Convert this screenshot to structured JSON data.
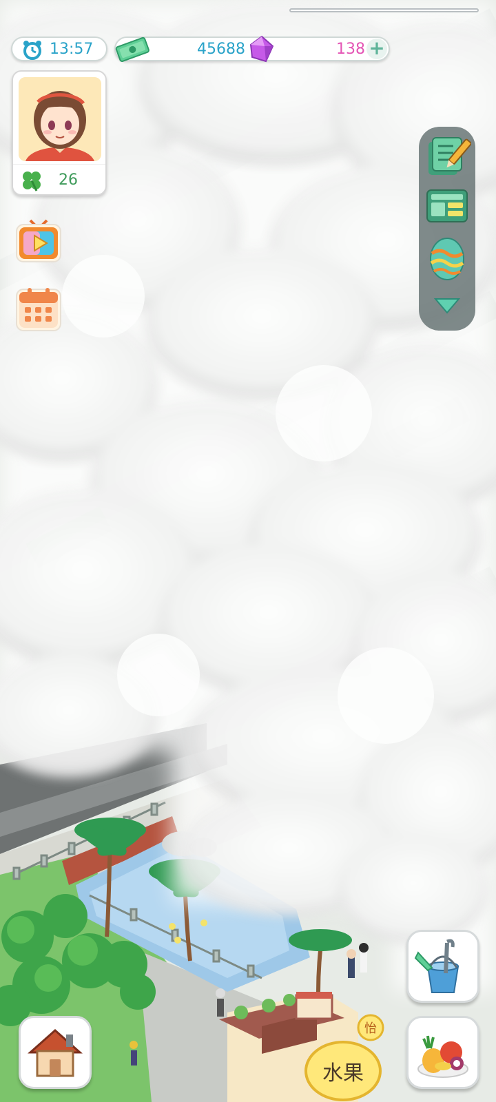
{
  "hud": {
    "time": "13:57",
    "cash": "45688",
    "gems": "138",
    "add_label": "+",
    "level": "26"
  },
  "icons": {
    "clock": "alarm-clock-icon",
    "cash": "cash-bill-icon",
    "gem": "purple-gem-icon",
    "clover": "four-leaf-clover-icon",
    "video": "tv-play-icon",
    "calendar": "calendar-icon",
    "tasks": "task-list-pencil-icon",
    "news": "newspaper-icon",
    "egg": "easter-egg-icon",
    "collapse": "triangle-down-icon",
    "bucket": "bucket-tools-icon",
    "home": "house-icon",
    "fruit": "fruit-basket-icon"
  },
  "shop_sign": "水果",
  "shop_badge": "怡",
  "colors": {
    "accent_teal": "#2aa3c9",
    "gem_pink": "#e455b5",
    "level_green": "#3f9b5b",
    "panel_gray": "#697676"
  }
}
